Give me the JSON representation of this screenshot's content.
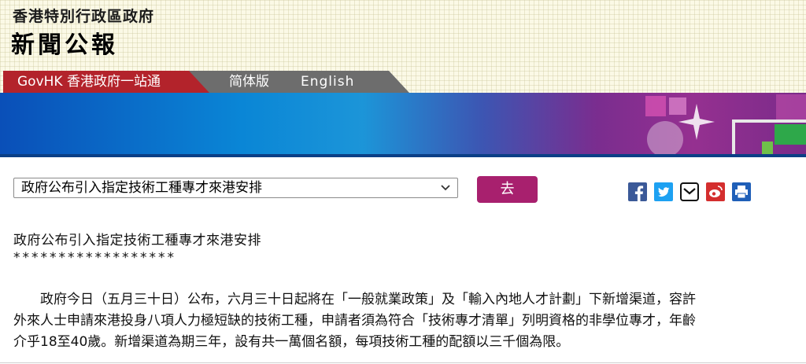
{
  "header": {
    "org_title": "香港特別行政區政府",
    "press_title": "新聞公報"
  },
  "tabs": {
    "govhk": "GovHK 香港政府一站通",
    "simplified": "简体版",
    "english": "English"
  },
  "nav": {
    "selected_article": "政府公布引入指定技術工種專才來港安排",
    "go_label": "去"
  },
  "share_icons": [
    "facebook-icon",
    "twitter-icon",
    "email-icon",
    "weibo-icon",
    "print-icon"
  ],
  "colors": {
    "brand_red": "#b3232b",
    "go_button": "#a8206e"
  },
  "article": {
    "title": "政府公布引入指定技術工種專才來港安排",
    "stars": "******************",
    "paragraph_lines": [
      "　　政府今日（五月三十日）公布，六月三十日起將在「一般就業政策」及「輸入內地人才計劃」下新增渠道，容許",
      "外來人士申請來港投身八項人力極短缺的技術工種，申請者須為符合「技術專才清單」列明資格的非學位專才，年齡",
      "介乎18至40歲。新增渠道為期三年，設有共一萬個名額，每項技術工種的配額以三千個為限。"
    ]
  }
}
